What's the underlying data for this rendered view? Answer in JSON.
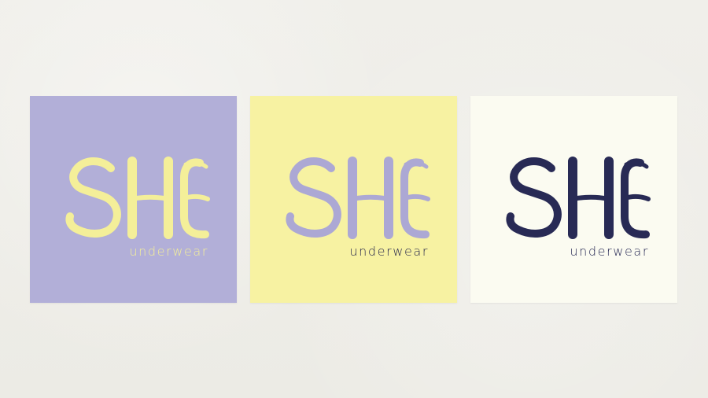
{
  "colors": {
    "background": "#efeee9",
    "lavender": "#b2afd8",
    "yellow": "#f7f2a2",
    "cream": "#fbfbf1",
    "navy": "#282a55"
  },
  "cards": [
    {
      "brand": "SHE",
      "tagline": "underwear",
      "background": "#b2afd8",
      "wordmark_color": "#f4ef99",
      "tagline_color": "#f4ef99"
    },
    {
      "brand": "SHE",
      "tagline": "underwear",
      "background": "#f7f2a2",
      "wordmark_color": "#aca8d4",
      "tagline_color": "#2a2a4d"
    },
    {
      "brand": "SHE",
      "tagline": "underwear",
      "background": "#fbfbf1",
      "wordmark_color": "#282a55",
      "tagline_color": "#282a55"
    }
  ]
}
